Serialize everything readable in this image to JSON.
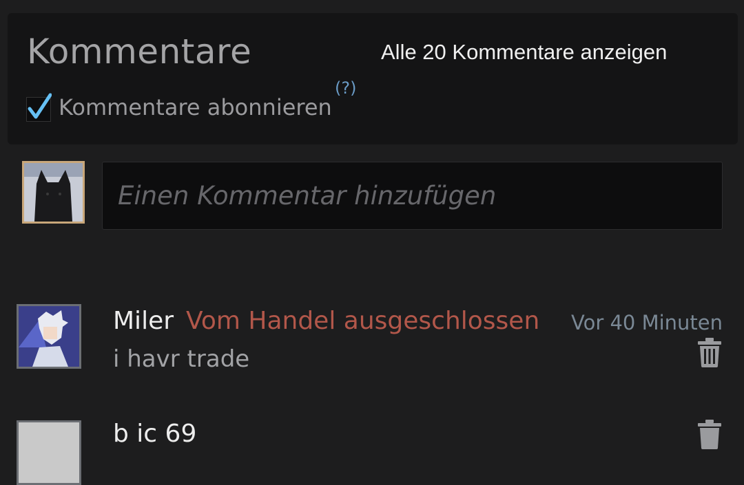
{
  "header": {
    "title": "Kommentare",
    "view_all_label": "Alle 20 Kommentare anzeigen",
    "subscribe_label": "Kommentare abonnieren",
    "subscribe_checked": true,
    "help_label": "(?)"
  },
  "composer": {
    "placeholder": "Einen Kommentar hinzufügen"
  },
  "comments": [
    {
      "author": "Miler",
      "status": "Vom Handel ausgeschlossen",
      "time": "Vor 40 Minuten",
      "text": "i havr trade"
    },
    {
      "author": "b          ic 69"
    }
  ],
  "colors": {
    "background": "#1d1d1e",
    "panel": "#141415",
    "ban_red": "#b2574a",
    "time_blue": "#7a8895",
    "help_blue": "#6a9bc6",
    "check_blue": "#66c0f4"
  },
  "icons": [
    "checkmark-icon",
    "trash-icon"
  ]
}
